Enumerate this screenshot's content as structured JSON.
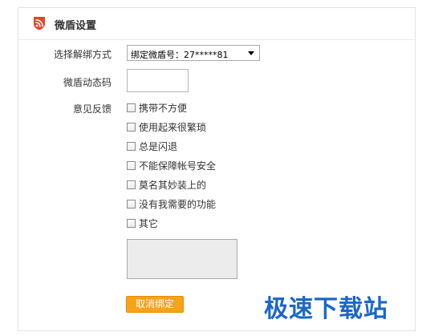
{
  "header": {
    "title": "微盾设置",
    "logo_icon": "wifi-shield-icon",
    "accent_color": "#e3452b"
  },
  "form": {
    "unbind_method": {
      "label": "选择解绑方式",
      "selected": "绑定微盾号：27*****81"
    },
    "dynamic_code": {
      "label": "微盾动态码",
      "value": ""
    },
    "feedback": {
      "label": "意见反馈",
      "options": [
        "携带不方便",
        "使用起来很繁琐",
        "总是闪退",
        "不能保障帐号安全",
        "莫名其妙装上的",
        "没有我需要的功能",
        "其它"
      ],
      "text": ""
    },
    "submit_label": "取消绑定",
    "submit_color": "#f7a21b"
  },
  "watermark": {
    "text": "极速下载站",
    "color": "#1c67c9"
  }
}
